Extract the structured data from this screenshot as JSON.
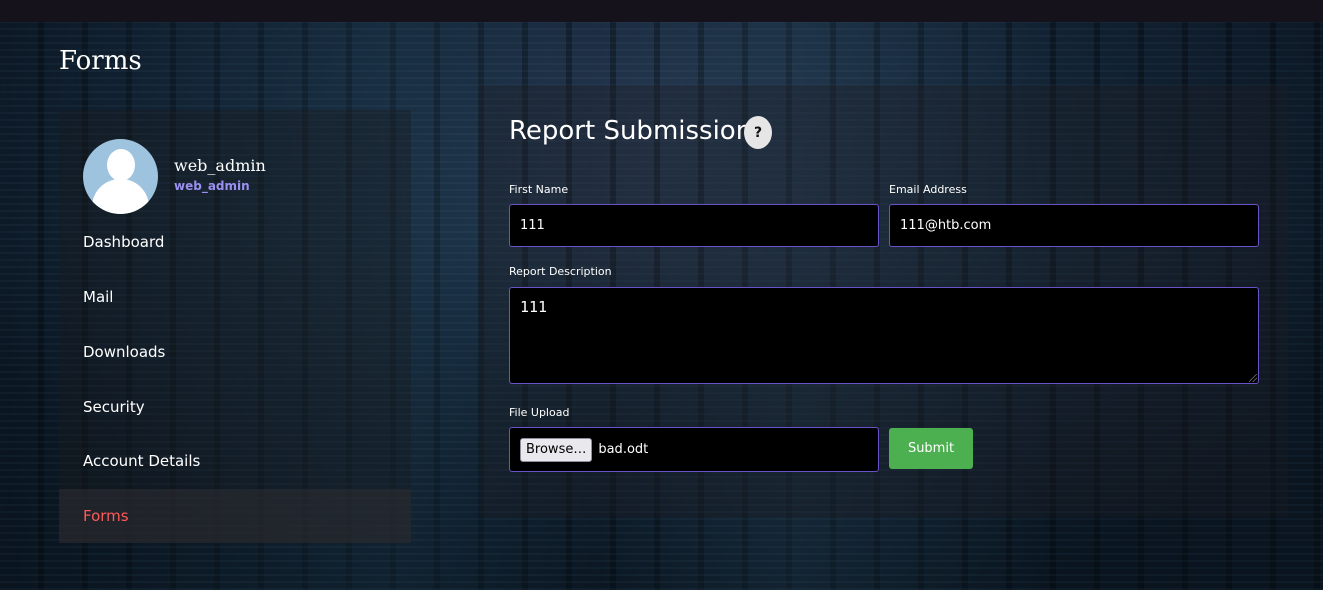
{
  "page": {
    "heading": "Forms"
  },
  "user": {
    "name": "web_admin",
    "role": "web_admin"
  },
  "sidebar": {
    "items": [
      {
        "label": "Dashboard",
        "active": false
      },
      {
        "label": "Mail",
        "active": false
      },
      {
        "label": "Downloads",
        "active": false
      },
      {
        "label": "Security",
        "active": false
      },
      {
        "label": "Account Details",
        "active": false
      },
      {
        "label": "Forms",
        "active": true
      }
    ]
  },
  "form": {
    "title": "Report Submission",
    "help_glyph": "?",
    "first_name": {
      "label": "First Name",
      "value": "111"
    },
    "email": {
      "label": "Email Address",
      "value": "111@htb.com"
    },
    "description": {
      "label": "Report Description",
      "value": "111"
    },
    "file": {
      "label": "File Upload",
      "browse_label": "Browse…",
      "file_name": "bad.odt"
    },
    "submit_label": "Submit"
  },
  "colors": {
    "accent_border": "#6a52c8",
    "active_nav": "#ff5a5a",
    "role_text": "#9b8ff0",
    "submit": "#4caf50"
  },
  "icons": [
    "user-avatar-icon",
    "help-icon"
  ]
}
